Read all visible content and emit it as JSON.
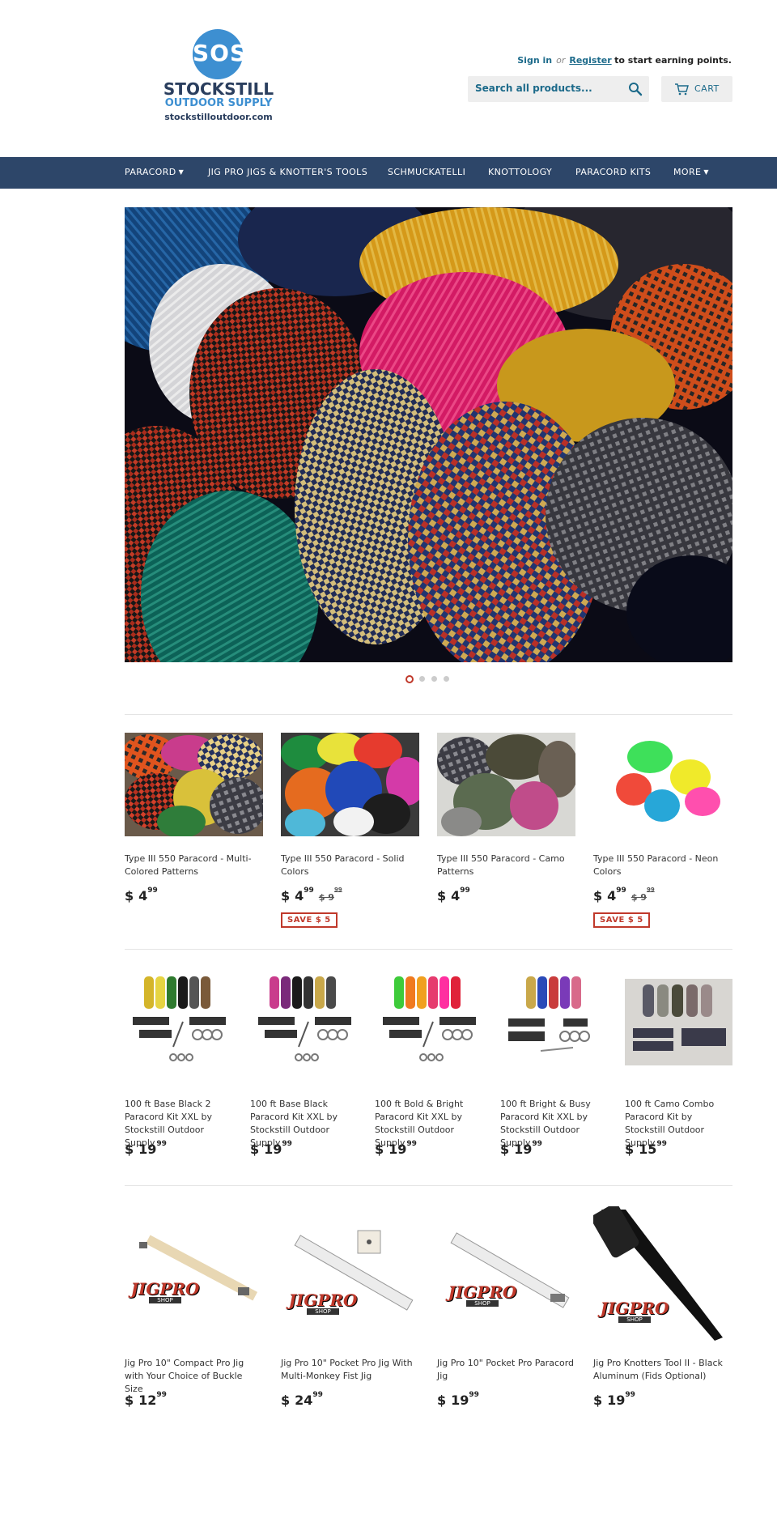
{
  "brand": {
    "logo_letters": "SOS",
    "name": "STOCKSTILL",
    "subtitle": "OUTDOOR SUPPLY",
    "url": "stockstilloutdoor.com",
    "primary_color": "#2a3e5e",
    "accent_color": "#3d8fd1"
  },
  "account": {
    "sign_in": "Sign in",
    "or": "or",
    "register": "Register",
    "suffix": "to start earning points."
  },
  "search": {
    "placeholder": "Search all products...",
    "icon": "search-icon"
  },
  "cart": {
    "label": "CART",
    "icon": "cart-icon"
  },
  "nav": {
    "items": [
      {
        "label": "PARACORD",
        "has_dropdown": true
      },
      {
        "label": "JIG PRO JIGS & KNOTTER'S TOOLS",
        "has_dropdown": false
      },
      {
        "label": "SCHMUCKATELLI",
        "has_dropdown": false
      },
      {
        "label": "KNOTTOLOGY",
        "has_dropdown": false
      },
      {
        "label": "PARACORD KITS",
        "has_dropdown": false
      },
      {
        "label": "MORE",
        "has_dropdown": true
      }
    ],
    "background": "#2d4669"
  },
  "slideshow": {
    "slide_count": 4,
    "active_index": 0
  },
  "collections": [
    {
      "products": [
        {
          "title": "Type III 550 Paracord - Multi-Colored Patterns",
          "currency": "$",
          "price_main": "4",
          "price_cents": "99",
          "compare_main": "",
          "compare_cents": "",
          "badge": ""
        },
        {
          "title": "Type III 550 Paracord - Solid Colors",
          "currency": "$",
          "price_main": "4",
          "price_cents": "99",
          "compare_main": "$ 9",
          "compare_cents": "99",
          "badge": "SAVE $ 5"
        },
        {
          "title": "Type III 550 Paracord - Camo Patterns",
          "currency": "$",
          "price_main": "4",
          "price_cents": "99",
          "compare_main": "",
          "compare_cents": "",
          "badge": ""
        },
        {
          "title": "Type III 550 Paracord - Neon Colors",
          "currency": "$",
          "price_main": "4",
          "price_cents": "99",
          "compare_main": "$ 9",
          "compare_cents": "99",
          "badge": "SAVE $ 5"
        }
      ]
    },
    {
      "products": [
        {
          "title": "100 ft Base Black 2 Paracord Kit XXL by Stockstill Outdoor Supply",
          "currency": "$",
          "price_main": "19",
          "price_cents": "99"
        },
        {
          "title": "100 ft Base Black Paracord Kit XXL by Stockstill Outdoor Supply",
          "currency": "$",
          "price_main": "19",
          "price_cents": "99"
        },
        {
          "title": "100 ft Bold & Bright Paracord Kit XXL by Stockstill Outdoor Supply",
          "currency": "$",
          "price_main": "19",
          "price_cents": "99"
        },
        {
          "title": "100 ft Bright & Busy Paracord Kit XXL by Stockstill Outdoor Supply",
          "currency": "$",
          "price_main": "19",
          "price_cents": "99"
        },
        {
          "title": "100 ft Camo Combo Paracord Kit by Stockstill Outdoor Supply",
          "currency": "$",
          "price_main": "15",
          "price_cents": "99"
        }
      ]
    },
    {
      "products": [
        {
          "title": "Jig Pro 10\" Compact Pro Jig with Your Choice of Buckle Size",
          "currency": "$",
          "price_main": "12",
          "price_cents": "99"
        },
        {
          "title": "Jig Pro 10\" Pocket Pro Jig With Multi-Monkey Fist Jig",
          "currency": "$",
          "price_main": "24",
          "price_cents": "99"
        },
        {
          "title": "Jig Pro 10\" Pocket Pro Paracord Jig",
          "currency": "$",
          "price_main": "19",
          "price_cents": "99"
        },
        {
          "title": "Jig Pro Knotters Tool II - Black Aluminum (Fids Optional)",
          "currency": "$",
          "price_main": "19",
          "price_cents": "99"
        }
      ]
    }
  ],
  "jigpro_logo": {
    "line1": "JIGPRO",
    "line2": "SHOP"
  },
  "colors": {
    "link": "#1c6a8a",
    "sale": "#c0392b",
    "nav_bg": "#2d4669"
  }
}
